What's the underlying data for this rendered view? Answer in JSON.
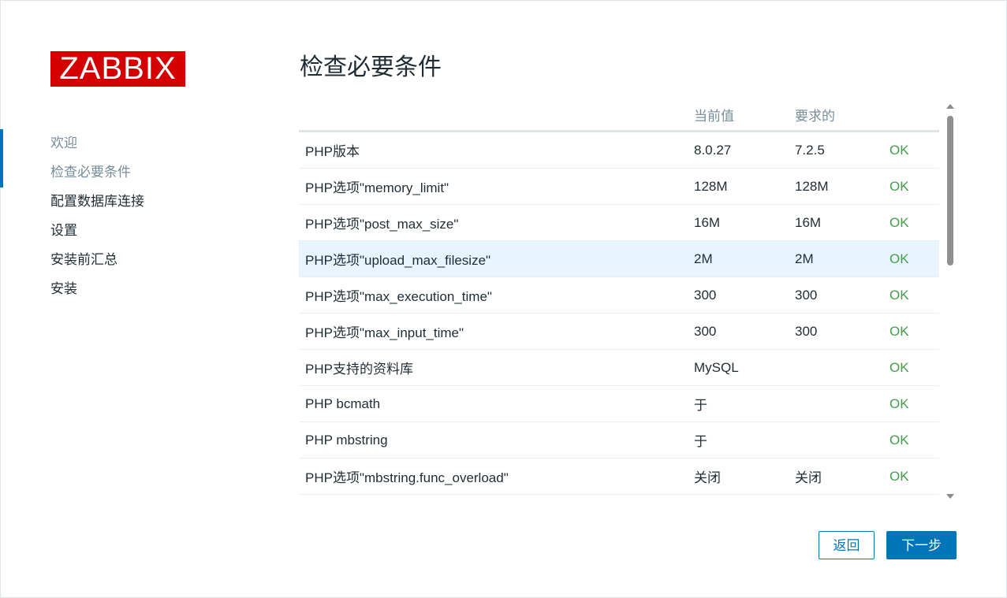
{
  "logo": {
    "text": "ZABBIX",
    "color": "#d40000"
  },
  "sidebar": {
    "items": [
      {
        "label": "欢迎",
        "state": "done"
      },
      {
        "label": "检查必要条件",
        "state": "current"
      },
      {
        "label": "配置数据库连接",
        "state": "pending"
      },
      {
        "label": "设置",
        "state": "pending"
      },
      {
        "label": "安装前汇总",
        "state": "pending"
      },
      {
        "label": "安装",
        "state": "pending"
      }
    ],
    "accent_color": "#0275b8"
  },
  "main": {
    "title": "检查必要条件",
    "table": {
      "headers": [
        "",
        "当前值",
        "要求的",
        ""
      ],
      "rows": [
        {
          "name": "PHP版本",
          "current": "8.0.27",
          "required": "7.2.5",
          "status": "OK"
        },
        {
          "name": "PHP选项\"memory_limit\"",
          "current": "128M",
          "required": "128M",
          "status": "OK"
        },
        {
          "name": "PHP选项\"post_max_size\"",
          "current": "16M",
          "required": "16M",
          "status": "OK"
        },
        {
          "name": "PHP选项\"upload_max_filesize\"",
          "current": "2M",
          "required": "2M",
          "status": "OK"
        },
        {
          "name": "PHP选项\"max_execution_time\"",
          "current": "300",
          "required": "300",
          "status": "OK"
        },
        {
          "name": "PHP选项\"max_input_time\"",
          "current": "300",
          "required": "300",
          "status": "OK"
        },
        {
          "name": "PHP支持的资料库",
          "current": "MySQL",
          "required": "",
          "status": "OK"
        },
        {
          "name": "PHP bcmath",
          "current": "于",
          "required": "",
          "status": "OK"
        },
        {
          "name": "PHP mbstring",
          "current": "于",
          "required": "",
          "status": "OK"
        },
        {
          "name": "PHP选项\"mbstring.func_overload\"",
          "current": "关闭",
          "required": "关闭",
          "status": "OK"
        }
      ],
      "status_color": "#429e47"
    }
  },
  "buttons": {
    "back_label": "返回",
    "next_label": "下一步"
  }
}
